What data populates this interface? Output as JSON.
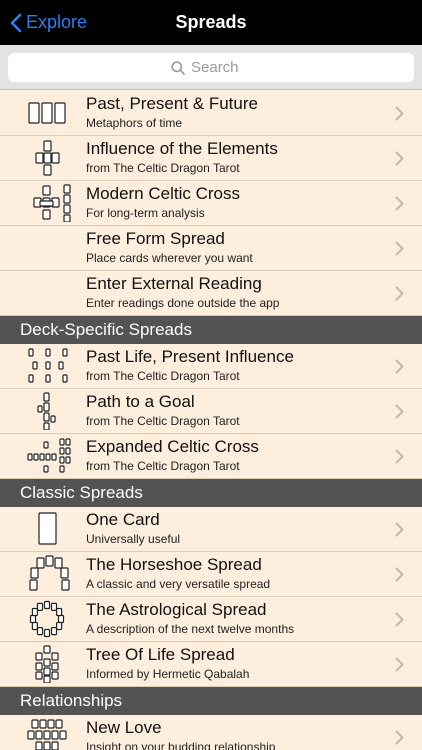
{
  "nav": {
    "back_label": "Explore",
    "title": "Spreads"
  },
  "search": {
    "placeholder": "Search"
  },
  "groups": [
    {
      "header": "",
      "rows": [
        {
          "title": "Past, Present & Future",
          "subtitle": "Metaphors of time",
          "icon": "three-card-spread-icon"
        },
        {
          "title": "Influence of the Elements",
          "subtitle": "from The Celtic Dragon Tarot",
          "icon": "elements-spread-icon"
        },
        {
          "title": "Modern Celtic Cross",
          "subtitle": "For long-term analysis",
          "icon": "celtic-cross-spread-icon"
        },
        {
          "title": "Free Form Spread",
          "subtitle": "Place cards wherever you want",
          "icon": ""
        },
        {
          "title": "Enter External Reading",
          "subtitle": "Enter readings done outside the app",
          "icon": ""
        }
      ]
    },
    {
      "header": "Deck-Specific Spreads",
      "rows": [
        {
          "title": "Past Life, Present Influence",
          "subtitle": "from The Celtic Dragon Tarot",
          "icon": "past-life-spread-icon"
        },
        {
          "title": "Path to a Goal",
          "subtitle": "from The Celtic Dragon Tarot",
          "icon": "path-spread-icon"
        },
        {
          "title": "Expanded Celtic Cross",
          "subtitle": "from The Celtic Dragon Tarot",
          "icon": "expanded-cross-spread-icon"
        }
      ]
    },
    {
      "header": "Classic Spreads",
      "rows": [
        {
          "title": "One Card",
          "subtitle": "Universally useful",
          "icon": "one-card-icon"
        },
        {
          "title": "The Horseshoe Spread",
          "subtitle": "A classic and very versatile spread",
          "icon": "horseshoe-spread-icon"
        },
        {
          "title": "The Astrological Spread",
          "subtitle": "A description of the next twelve months",
          "icon": "astrological-spread-icon"
        },
        {
          "title": "Tree Of Life Spread",
          "subtitle": "Informed by Hermetic Qabalah",
          "icon": "tree-of-life-spread-icon"
        }
      ]
    },
    {
      "header": "Relationships",
      "rows": [
        {
          "title": "New Love",
          "subtitle": "Insight on your budding relationship",
          "icon": "new-love-spread-icon"
        }
      ]
    }
  ]
}
